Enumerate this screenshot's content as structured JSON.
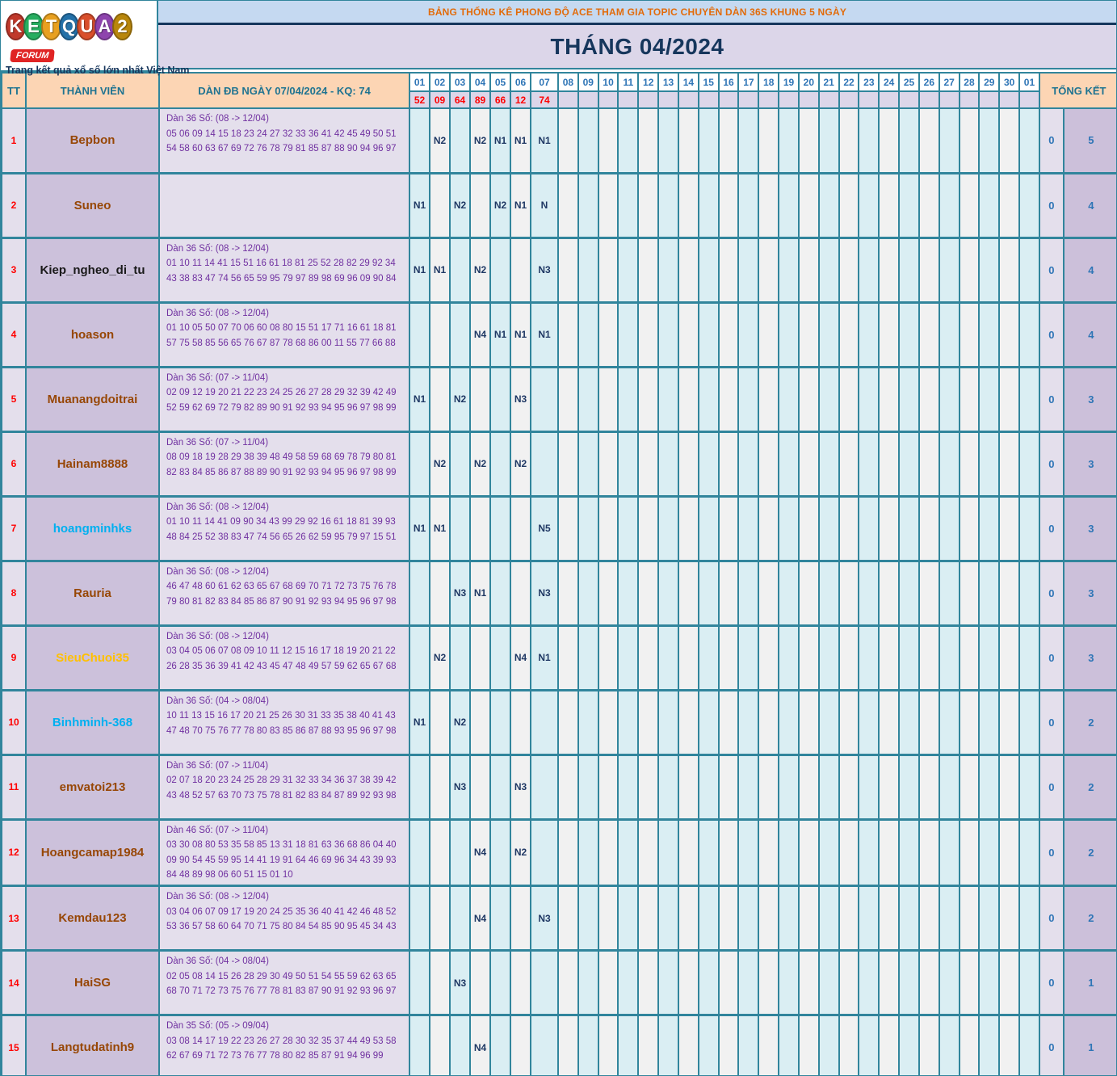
{
  "logo": {
    "letters": [
      "K",
      "E",
      "T",
      "Q",
      "U",
      "A",
      "2"
    ],
    "letter_colors": [
      "#c0392b",
      "#27ae60",
      "#e8a020",
      "#2471a8",
      "#d94f2b",
      "#8e44ad",
      "#b8860b"
    ],
    "forum_badge": "FORUM",
    "tagline": "Trang kết quả xổ số lớn nhất Việt Nam"
  },
  "header": {
    "topic_title": "BẢNG THỐNG KÊ PHONG ĐỘ ACE THAM GIA TOPIC CHUYÊN DÀN 36S KHUNG 5 NGÀY",
    "month_title": "THÁNG 04/2024"
  },
  "table": {
    "col_headers": {
      "tt": "TT",
      "member": "THÀNH VIÊN",
      "dan": "DÀN ĐB NGÀY 07/04/2024 - KQ: 74",
      "total": "TỔNG KẾT"
    },
    "day_columns": [
      "01",
      "02",
      "03",
      "04",
      "05",
      "06",
      "07",
      "08",
      "09",
      "10",
      "11",
      "12",
      "13",
      "14",
      "15",
      "16",
      "17",
      "18",
      "19",
      "20",
      "21",
      "22",
      "23",
      "24",
      "25",
      "26",
      "27",
      "28",
      "29",
      "30",
      "01"
    ],
    "results": [
      "52",
      "09",
      "64",
      "89",
      "66",
      "12",
      "74"
    ],
    "rows": [
      {
        "tt": "1",
        "member": "Bepbon",
        "color": "#974706",
        "dan_title": "Dàn 36 Số: (08 -> 12/04)",
        "dan_nums": "05 06 09 14 15 18 23 24 27 32 33 36 41 42 45 49 50 51 54 58 60 63 67 69 72 76 78 79 81 85 87 88 90 94 96 97",
        "marks": {
          "2": "N2",
          "4": "N2",
          "5": "N1",
          "6": "N1",
          "7": "N1"
        },
        "zero": "0",
        "total": "5"
      },
      {
        "tt": "2",
        "member": "Suneo",
        "color": "#974706",
        "dan_title": "",
        "dan_nums": "",
        "marks": {
          "1": "N1",
          "3": "N2",
          "5": "N2",
          "6": "N1",
          "7": "N"
        },
        "zero": "0",
        "total": "4"
      },
      {
        "tt": "3",
        "member": "Kiep_ngheo_di_tu",
        "color": "#1a1a1a",
        "dan_title": "Dàn 36 Số: (08 -> 12/04)",
        "dan_nums": "01 10 11 14 41 15 51 16 61 18 81 25 52 28 82 29 92 34 43 38 83 47 74 56 65 59 95 79 97 89 98 69 96 09 90 84",
        "marks": {
          "1": "N1",
          "2": "N1",
          "4": "N2",
          "7": "N3"
        },
        "zero": "0",
        "total": "4"
      },
      {
        "tt": "4",
        "member": "hoason",
        "color": "#974706",
        "dan_title": "Dàn 36 Số: (08 -> 12/04)",
        "dan_nums": "01 10 05 50 07 70 06 60 08 80 15 51 17 71 16 61 18 81 57 75 58 85 56 65 76 67 87 78 68 86 00 11 55 77 66 88",
        "marks": {
          "4": "N4",
          "5": "N1",
          "6": "N1",
          "7": "N1"
        },
        "zero": "0",
        "total": "4"
      },
      {
        "tt": "5",
        "member": "Muanangdoitrai",
        "color": "#974706",
        "dan_title": "Dàn 36 Số: (07 -> 11/04)",
        "dan_nums": "02 09 12 19 20 21 22 23 24 25 26 27 28 29 32 39 42 49 52 59 62 69 72 79 82 89 90 91 92 93 94 95 96 97 98 99",
        "marks": {
          "1": "N1",
          "3": "N2",
          "6": "N3"
        },
        "zero": "0",
        "total": "3"
      },
      {
        "tt": "6",
        "member": "Hainam8888",
        "color": "#974706",
        "dan_title": "Dàn 36 Số: (07 -> 11/04)",
        "dan_nums": "08 09 18 19 28 29 38 39 48 49 58 59 68 69 78 79 80 81 82 83 84 85 86 87 88 89 90 91 92 93 94 95 96 97 98 99",
        "marks": {
          "2": "N2",
          "4": "N2",
          "6": "N2"
        },
        "zero": "0",
        "total": "3"
      },
      {
        "tt": "7",
        "member": "hoangminhks",
        "color": "#00b0f0",
        "dan_title": "Dàn 36 Số: (08 -> 12/04)",
        "dan_nums": "01 10 11 14 41 09 90 34 43 99 29 92 16 61 18 81 39 93 48 84 25 52 38 83 47 74 56 65 26 62 59 95 79 97 15 51",
        "marks": {
          "1": "N1",
          "2": "N1",
          "7": "N5"
        },
        "zero": "0",
        "total": "3"
      },
      {
        "tt": "8",
        "member": "Rauria",
        "color": "#974706",
        "dan_title": "Dàn 36 Số: (08 -> 12/04)",
        "dan_nums": "46 47 48 60 61 62 63 65 67 68 69 70 71 72 73 75 76 78 79 80 81 82 83 84 85 86 87 90 91 92 93 94 95 96 97 98",
        "marks": {
          "3": "N3",
          "4": "N1",
          "7": "N3"
        },
        "zero": "0",
        "total": "3"
      },
      {
        "tt": "9",
        "member": "SieuChuoi35",
        "color": "#ffc000",
        "dan_title": "Dàn 36 Số: (08 -> 12/04)",
        "dan_nums": "03 04 05 06 07 08 09 10 11 12 15 16 17 18 19 20 21 22 26 28 35 36 39 41 42 43 45 47 48 49 57 59 62 65 67 68",
        "marks": {
          "2": "N2",
          "6": "N4",
          "7": "N1"
        },
        "zero": "0",
        "total": "3"
      },
      {
        "tt": "10",
        "member": "Binhminh-368",
        "color": "#00b0f0",
        "dan_title": "Dàn 36 Số: (04 -> 08/04)",
        "dan_nums": "10 11 13 15 16 17 20 21 25 26 30 31 33 35 38 40 41 43 47 48 70 75 76 77 78 80 83 85 86 87 88 93 95 96 97 98",
        "marks": {
          "1": "N1",
          "3": "N2"
        },
        "zero": "0",
        "total": "2"
      },
      {
        "tt": "11",
        "member": "emvatoi213",
        "color": "#974706",
        "dan_title": "Dàn 36 Số: (07 -> 11/04)",
        "dan_nums": "02 07 18 20 23 24 25 28 29 31 32 33 34 36 37 38 39 42 43 48 52 57 63 70 73 75 78 81 82 83 84 87 89 92 93 98",
        "marks": {
          "3": "N3",
          "6": "N3"
        },
        "zero": "0",
        "total": "2"
      },
      {
        "tt": "12",
        "member": "Hoangcamap1984",
        "color": "#974706",
        "dan_title": "Dàn 46 Số: (07 -> 11/04)",
        "dan_nums": "03 30 08 80 53 35 58 85 13 31 18 81 63 36 68 86 04 40 09 90 54 45 59 95 14 41 19 91 64 46 69 96 34 43 39 93 84 48 89 98 06 60 51 15 01 10",
        "marks": {
          "4": "N4",
          "6": "N2"
        },
        "zero": "0",
        "total": "2"
      },
      {
        "tt": "13",
        "member": "Kemdau123",
        "color": "#974706",
        "dan_title": "Dàn 36 Số: (08 -> 12/04)",
        "dan_nums": "03 04 06 07 09 17 19 20 24 25 35 36 40 41 42 46 48 52 53 36 57 58 60 64 70 71 75 80 84 54 85 90 95 45 34 43",
        "marks": {
          "4": "N4",
          "7": "N3"
        },
        "zero": "0",
        "total": "2"
      },
      {
        "tt": "14",
        "member": "HaiSG",
        "color": "#974706",
        "dan_title": "Dàn 36 Số: (04 -> 08/04)",
        "dan_nums": "02 05 08 14 15 26 28 29 30 49 50 51 54 55 59 62 63 65 68 70 71 72 73 75 76 77 78 81 83 87 90 91 92 93 96 97",
        "marks": {
          "3": "N3"
        },
        "zero": "0",
        "total": "1"
      },
      {
        "tt": "15",
        "member": "Langtudatinh9",
        "color": "#974706",
        "dan_title": "Dàn 35 Số: (05 -> 09/04)",
        "dan_nums": "03 08 14 17 19 22 23 26 27 28 30 32 35 37 44 49 53 58 62 67 69 71 72 73 76 77 78 80 82 85 87 91 94 96 99",
        "marks": {
          "4": "N4"
        },
        "zero": "0",
        "total": "1"
      }
    ]
  }
}
